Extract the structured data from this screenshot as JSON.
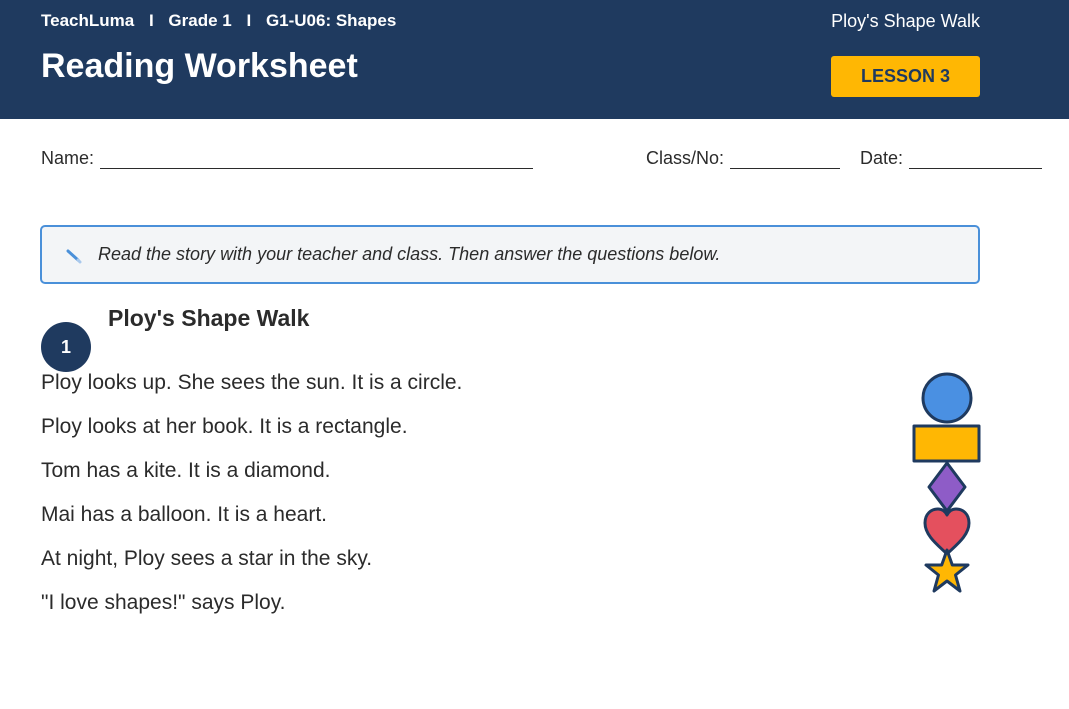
{
  "header": {
    "brand": "TeachLuma",
    "grade": "Grade 1",
    "unit": "G1-U06: Shapes",
    "separator": "I",
    "story_name": "Ploy's Shape Walk",
    "title": "Reading Worksheet",
    "lesson_badge": "LESSON 3"
  },
  "fields": {
    "name_label": "Name:",
    "class_label": "Class/No:",
    "date_label": "Date:"
  },
  "instruction": {
    "icon": "pencil-icon",
    "text": "Read the story with your teacher and class. Then answer the questions below."
  },
  "story": {
    "number": "1",
    "title": "Ploy's Shape Walk",
    "lines": [
      "Ploy looks up. She sees the sun. It is a circle.",
      "Ploy looks at her book. It is a rectangle.",
      "Tom has a kite. It is a diamond.",
      "Mai has a balloon. It is a heart.",
      "At night, Ploy sees a star in the sky.",
      "\"I love shapes!\" says Ploy."
    ]
  },
  "illustration": {
    "shapes": [
      {
        "name": "circle",
        "color": "#4a90e2"
      },
      {
        "name": "rectangle",
        "color": "#ffb703"
      },
      {
        "name": "diamond",
        "color": "#8e5cc7"
      },
      {
        "name": "heart",
        "color": "#e4505e"
      },
      {
        "name": "star",
        "color": "#ffb703"
      }
    ],
    "outline_color": "#1f3a5f"
  }
}
